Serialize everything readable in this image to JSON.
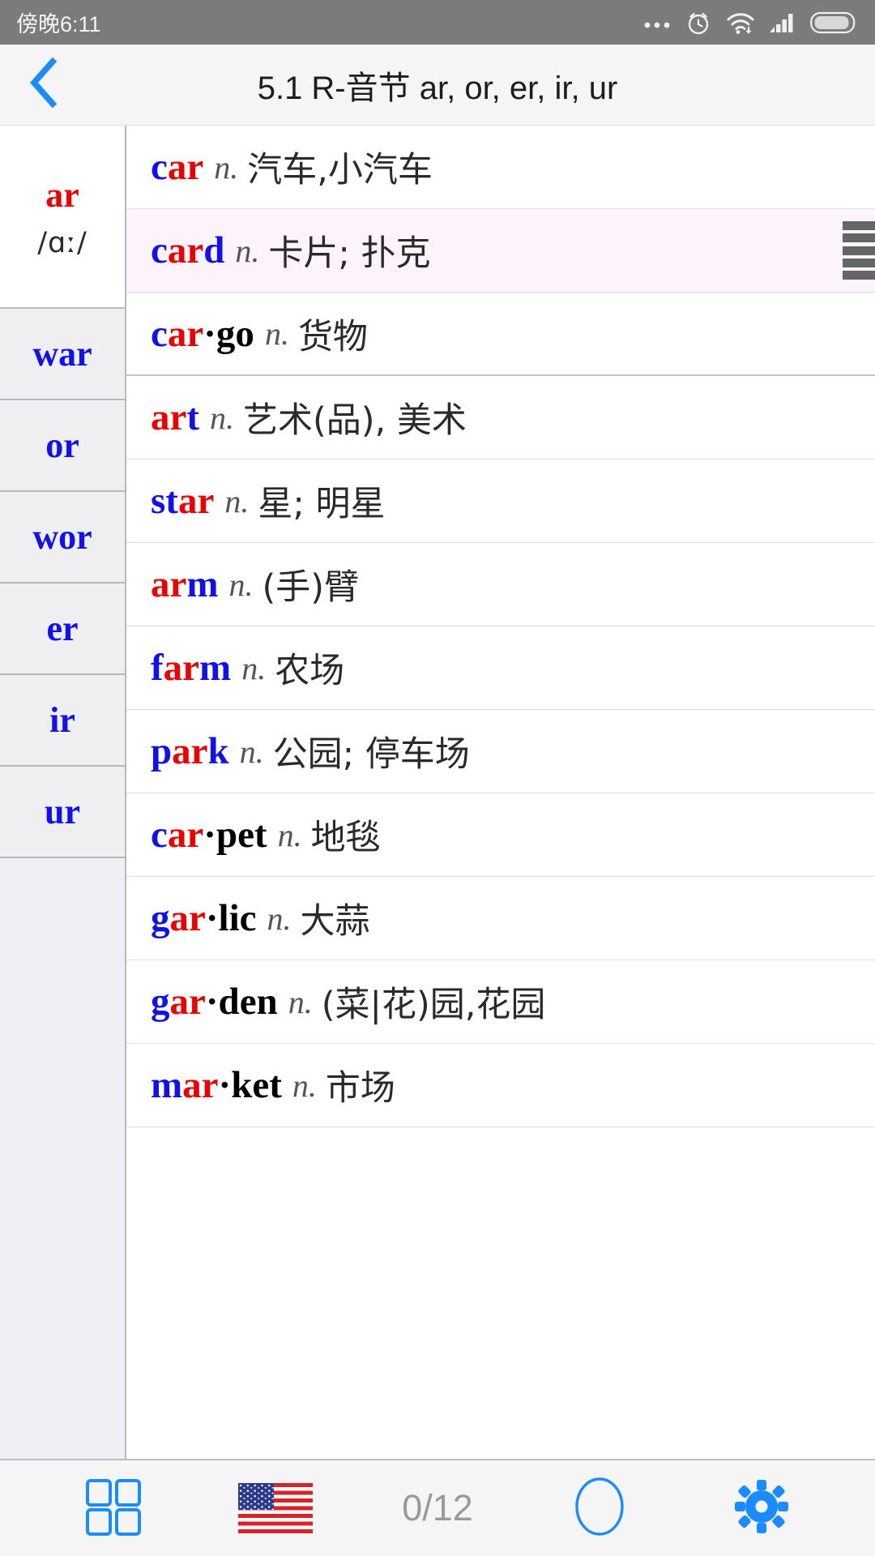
{
  "statusbar": {
    "time": "傍晚6:11",
    "icons": [
      "more-dots-icon",
      "alarm-clock-icon",
      "wifi-icon",
      "signal-icon",
      "battery-icon"
    ]
  },
  "titlebar": {
    "back_icon": "chevron-left-icon",
    "title": "5.1 R-音节 ar, or, er, ir, ur"
  },
  "sidebar": {
    "items": [
      {
        "label": "ar",
        "ipa": "/ɑː/",
        "active": true
      },
      {
        "label": "war",
        "ipa": "",
        "active": false
      },
      {
        "label": "or",
        "ipa": "",
        "active": false
      },
      {
        "label": "wor",
        "ipa": "",
        "active": false
      },
      {
        "label": "er",
        "ipa": "",
        "active": false
      },
      {
        "label": "ir",
        "ipa": "",
        "active": false
      },
      {
        "label": "ur",
        "ipa": "",
        "active": false
      }
    ]
  },
  "wordlist": {
    "rows": [
      {
        "word": "car",
        "segments": [
          {
            "t": "c",
            "c": "b"
          },
          {
            "t": "ar",
            "c": "r"
          }
        ],
        "pos": "n.",
        "meaning": "汽车,小汽车",
        "selected": false,
        "thick": false
      },
      {
        "word": "card",
        "segments": [
          {
            "t": "c",
            "c": "b"
          },
          {
            "t": "ar",
            "c": "r"
          },
          {
            "t": "d",
            "c": "b"
          }
        ],
        "pos": "n.",
        "meaning": "卡片; 扑克",
        "selected": true,
        "thick": false
      },
      {
        "word": "car·go",
        "segments": [
          {
            "t": "c",
            "c": "b"
          },
          {
            "t": "ar",
            "c": "r"
          },
          {
            "t": "·go",
            "c": "k"
          }
        ],
        "pos": "n.",
        "meaning": "货物",
        "selected": false,
        "thick": true
      },
      {
        "word": "art",
        "segments": [
          {
            "t": "ar",
            "c": "r"
          },
          {
            "t": "t",
            "c": "b"
          }
        ],
        "pos": "n.",
        "meaning": "艺术(品), 美术",
        "selected": false,
        "thick": false
      },
      {
        "word": "star",
        "segments": [
          {
            "t": "st",
            "c": "b"
          },
          {
            "t": "ar",
            "c": "r"
          }
        ],
        "pos": "n.",
        "meaning": "星; 明星",
        "selected": false,
        "thick": false
      },
      {
        "word": "arm",
        "segments": [
          {
            "t": "ar",
            "c": "r"
          },
          {
            "t": "m",
            "c": "b"
          }
        ],
        "pos": "n.",
        "meaning": "(手)臂",
        "selected": false,
        "thick": false
      },
      {
        "word": "farm",
        "segments": [
          {
            "t": "f",
            "c": "b"
          },
          {
            "t": "ar",
            "c": "r"
          },
          {
            "t": "m",
            "c": "b"
          }
        ],
        "pos": "n.",
        "meaning": "农场",
        "selected": false,
        "thick": false
      },
      {
        "word": "park",
        "segments": [
          {
            "t": "p",
            "c": "b"
          },
          {
            "t": "ar",
            "c": "r"
          },
          {
            "t": "k",
            "c": "b"
          }
        ],
        "pos": "n.",
        "meaning": "公园; 停车场",
        "selected": false,
        "thick": false
      },
      {
        "word": "car·pet",
        "segments": [
          {
            "t": "c",
            "c": "b"
          },
          {
            "t": "ar",
            "c": "r"
          },
          {
            "t": "·pet",
            "c": "k"
          }
        ],
        "pos": "n.",
        "meaning": "地毯",
        "selected": false,
        "thick": false
      },
      {
        "word": "gar·lic",
        "segments": [
          {
            "t": "g",
            "c": "b"
          },
          {
            "t": "ar",
            "c": "r"
          },
          {
            "t": "·lic",
            "c": "k"
          }
        ],
        "pos": "n.",
        "meaning": "大蒜",
        "selected": false,
        "thick": false
      },
      {
        "word": "gar·den",
        "segments": [
          {
            "t": "g",
            "c": "b"
          },
          {
            "t": "ar",
            "c": "r"
          },
          {
            "t": "·den",
            "c": "k"
          }
        ],
        "pos": "n.",
        "meaning": "(菜|花)园,花园",
        "selected": false,
        "thick": false
      },
      {
        "word": "mar·ket",
        "segments": [
          {
            "t": "m",
            "c": "b"
          },
          {
            "t": "ar",
            "c": "r"
          },
          {
            "t": "·ket",
            "c": "k"
          }
        ],
        "pos": "n.",
        "meaning": "市场",
        "selected": false,
        "thick": false
      }
    ],
    "drag_handle": "drag-handle-icon"
  },
  "toolbar": {
    "items": [
      {
        "name": "grid-icon",
        "label": ""
      },
      {
        "name": "us-flag-icon",
        "label": ""
      },
      {
        "name": "progress-counter",
        "label": "0/12"
      },
      {
        "name": "circle-icon",
        "label": ""
      },
      {
        "name": "gear-icon",
        "label": ""
      }
    ],
    "counter": "0/12"
  },
  "colors": {
    "accent_blue": "#1a8cff",
    "word_blue": "#1111ee",
    "word_red": "#ee0000",
    "statusbar_bg": "#7b7b7b",
    "titlebar_bg": "#f5f5f5",
    "selected_row_bg": "#fdf4fb",
    "sidebar_bg": "#efeff1"
  }
}
